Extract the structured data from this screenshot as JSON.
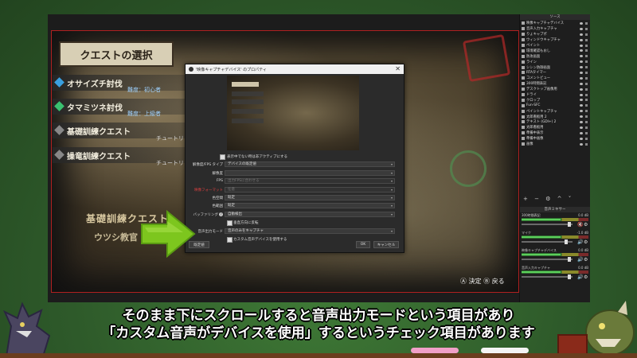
{
  "game": {
    "menu_title": "クエストの選択",
    "items": [
      {
        "label": "オサイズチ討伐",
        "sub": "難度：初心者"
      },
      {
        "label": "タマミツネ討伐",
        "sub": "難度：上級者"
      },
      {
        "label": "基礎訓練クエスト",
        "sub": "チュートリ"
      },
      {
        "label": "操竜訓練クエスト",
        "sub": "チュートリ"
      }
    ],
    "big_text": "基礎訓練クエスト",
    "npc_text": "ウツシ教官",
    "footer": "Ⓐ 決定 Ⓑ 戻る"
  },
  "dialog": {
    "title": "'映像キャプチャデバイス' のプロパティ",
    "rows": [
      {
        "type": "check",
        "label": "表示中でない時は非アクティブにする"
      },
      {
        "type": "select",
        "label": "解像度/FPS タイプ",
        "value": "デバイスの既定値",
        "label_color": "normal"
      },
      {
        "type": "select",
        "label": "解像度",
        "value": "",
        "label_color": "normal"
      },
      {
        "type": "select",
        "label": "FPS",
        "value": "出力FPSに合わせる",
        "label_color": "normal",
        "disabled": true
      },
      {
        "type": "select",
        "label": "映像フォーマット",
        "value": "任意",
        "label_color": "red",
        "disabled": true
      },
      {
        "type": "select",
        "label": "色空間",
        "value": "既定",
        "label_color": "normal"
      },
      {
        "type": "select",
        "label": "色範囲",
        "value": "既定",
        "label_color": "normal"
      },
      {
        "type": "select",
        "label": "バッファリング",
        "value": "自動検出",
        "label_color": "normal",
        "help": "?"
      },
      {
        "type": "check",
        "label": "垂直方向に反転"
      },
      {
        "type": "select",
        "label": "音声出力モード",
        "value": "音声のみをキャプチャ",
        "label_color": "normal"
      },
      {
        "type": "check",
        "label": "カスタム音声デバイスを使用する"
      }
    ],
    "defaults_button": "既定値",
    "ok_button": "OK",
    "cancel_button": "キャンセル"
  },
  "panel": {
    "sources_header": "ソース",
    "sources": [
      "映像キャプチャデバイス",
      "音声入力キャプチャ",
      "りょキャプポ",
      "ウィンドウキャプチャ",
      "ペイント",
      "環境確認もおし",
      "防攻画面",
      "ライン",
      "シシン防御画面",
      "RTAタイマー",
      "コメントビュー",
      "300時間表記",
      "デスクトップ画像用",
      "ドライ",
      "クロップ",
      "Fun-SFC",
      "ペイントキャプチャ",
      "太郎看板用 2",
      "テキスト (GDI+) 2",
      "太郎看板用",
      "準備中表示",
      "準備中画像",
      "画像"
    ],
    "tools": "+ − ⚙ ^ ˅",
    "mixer_header": "音声ミキサー",
    "mixer": [
      {
        "name": "300時間表記",
        "db": "0.0 dB",
        "muted": true
      },
      {
        "name": "マイク",
        "db": "-1.0 dB",
        "muted": false
      },
      {
        "name": "映像キャプチャデバイス",
        "db": "0.0 dB",
        "muted": false
      },
      {
        "name": "音声入力キャプチャ",
        "db": "0.0 dB",
        "muted": false
      }
    ]
  },
  "subtitle": {
    "line1": "そのまま下にスクロールすると音声出力モードという項目があり",
    "line2": "「カスタム音声がデバイスを使用」するというチェック項目があります"
  },
  "colors": {
    "arrow": "#7dc61e",
    "pink": "#f0a0c8",
    "white": "#f4f4f4"
  }
}
